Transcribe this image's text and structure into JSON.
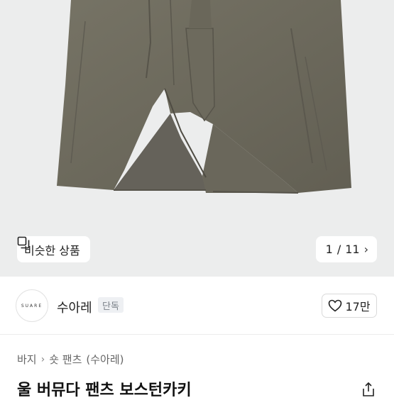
{
  "gallery": {
    "similar_label": "비슷한 상품",
    "page_current": "1",
    "page_separator": "/",
    "page_total": "11",
    "image_alt": "khaki wool bermuda shorts with belt"
  },
  "shop": {
    "logo_text": "SUARE",
    "name": "수아레",
    "badge": "단독",
    "like_count": "17만"
  },
  "breadcrumb": [
    "바지",
    "숏 팬츠",
    "(수아레)"
  ],
  "product": {
    "title": "울 버뮤다 팬츠 보스턴카키"
  },
  "colors": {
    "fabric": "#6f6c5f",
    "background": "#eceded"
  },
  "icons": {
    "similar": "similar-products-icon",
    "pager_next": "chevron-right-icon",
    "like": "heart-icon",
    "breadcrumb_sep": "chevron-right-icon",
    "share": "share-icon"
  }
}
